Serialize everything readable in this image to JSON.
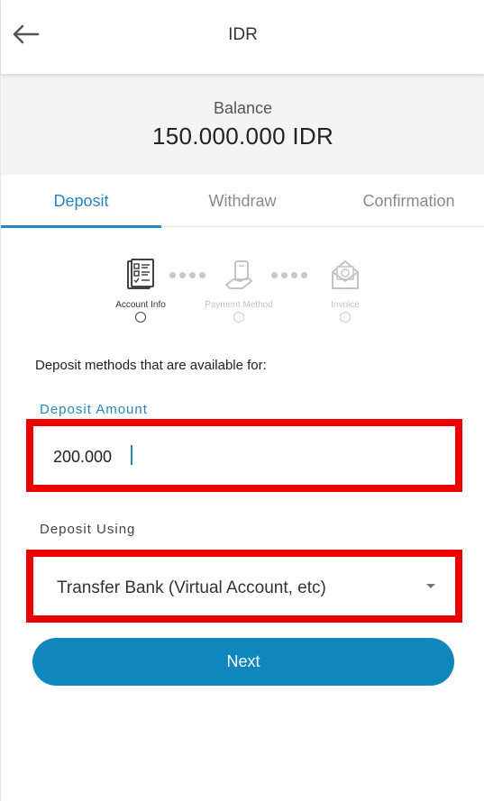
{
  "header": {
    "title": "IDR"
  },
  "balance": {
    "label": "Balance",
    "value": "150.000.000 IDR"
  },
  "tabs": [
    {
      "label": "Deposit",
      "active": true
    },
    {
      "label": "Withdraw",
      "active": false
    },
    {
      "label": "Confirmation",
      "active": false
    }
  ],
  "steps": [
    {
      "label": "Account Info",
      "icon": "account-info-icon",
      "active": true
    },
    {
      "label": "Payment Method",
      "icon": "payment-method-icon",
      "active": false
    },
    {
      "label": "Invoice",
      "icon": "invoice-icon",
      "active": false
    }
  ],
  "form": {
    "methods_text": "Deposit methods that are available for:",
    "amount_label": "Deposit Amount",
    "amount_value": "200.000",
    "using_label": "Deposit Using",
    "using_value": "Transfer Bank (Virtual Account, etc)",
    "next_label": "Next"
  },
  "colors": {
    "accent": "#0f87bd",
    "highlight": "#ee0000"
  }
}
